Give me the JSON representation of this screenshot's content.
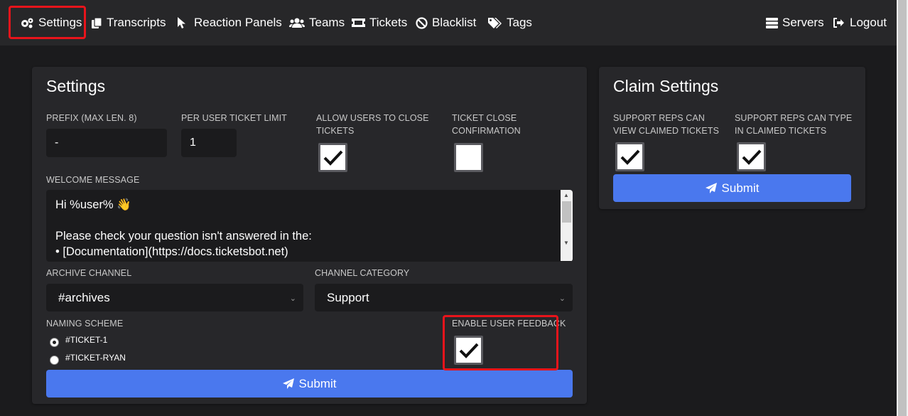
{
  "nav": {
    "settings": "Settings",
    "transcripts": "Transcripts",
    "reaction_panels": "Reaction Panels",
    "teams": "Teams",
    "tickets": "Tickets",
    "blacklist": "Blacklist",
    "tags": "Tags",
    "servers": "Servers",
    "logout": "Logout"
  },
  "settings_card": {
    "title": "Settings",
    "prefix_label": "PREFIX (MAX LEN. 8)",
    "prefix_value": "-",
    "ticket_limit_label": "PER USER TICKET LIMIT",
    "ticket_limit_value": "1",
    "allow_close_label": "ALLOW USERS TO CLOSE TICKETS",
    "allow_close_checked": true,
    "close_confirm_label": "TICKET CLOSE CONFIRMATION",
    "close_confirm_checked": false,
    "welcome_label": "WELCOME MESSAGE",
    "welcome_lines": [
      "Hi %user% 👋",
      "",
      "Please check your question isn't answered in the:",
      "• [Documentation](https://docs.ticketsbot.net)"
    ],
    "archive_label": "ARCHIVE CHANNEL",
    "archive_value": "#archives",
    "category_label": "CHANNEL CATEGORY",
    "category_value": "Support",
    "naming_label": "NAMING SCHEME",
    "naming_options": [
      "#TICKET-1",
      "#TICKET-RYAN"
    ],
    "naming_selected": 0,
    "feedback_label": "ENABLE USER FEEDBACK",
    "feedback_checked": true,
    "submit_label": "Submit"
  },
  "claim_card": {
    "title": "Claim Settings",
    "view_label": "SUPPORT REPS CAN VIEW CLAIMED TICKETS",
    "view_checked": true,
    "type_label": "SUPPORT REPS CAN TYPE IN CLAIMED TICKETS",
    "type_checked": true,
    "submit_label": "Submit"
  },
  "colors": {
    "accent": "#4a78ee",
    "highlight": "#e8141b",
    "card": "#27272a",
    "background": "#1b1b1d"
  }
}
